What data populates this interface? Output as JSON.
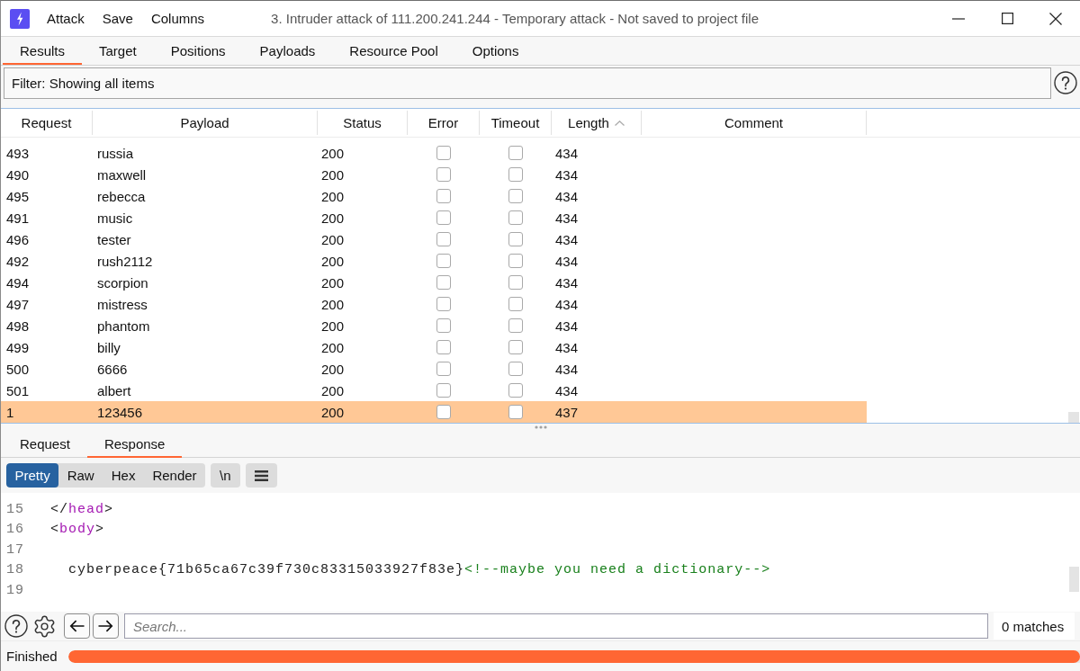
{
  "window": {
    "title": "3. Intruder attack of 111.200.241.244 - Temporary attack - Not saved to project file"
  },
  "menu": [
    "Attack",
    "Save",
    "Columns"
  ],
  "tabs": [
    {
      "label": "Results",
      "selected": true
    },
    {
      "label": "Target",
      "selected": false
    },
    {
      "label": "Positions",
      "selected": false
    },
    {
      "label": "Payloads",
      "selected": false
    },
    {
      "label": "Resource Pool",
      "selected": false
    },
    {
      "label": "Options",
      "selected": false
    }
  ],
  "filter": {
    "label": "Filter: Showing all items"
  },
  "table": {
    "columns": [
      {
        "label": "Request",
        "sorted": false
      },
      {
        "label": "Payload",
        "sorted": false
      },
      {
        "label": "Status",
        "sorted": false
      },
      {
        "label": "Error",
        "sorted": false
      },
      {
        "label": "Timeout",
        "sorted": false
      },
      {
        "label": "Length",
        "sorted": true
      },
      {
        "label": "Comment",
        "sorted": false
      }
    ],
    "rows": [
      {
        "request": "493",
        "payload": "russia",
        "status": "200",
        "error": false,
        "timeout": false,
        "length": "434",
        "selected": false
      },
      {
        "request": "490",
        "payload": "maxwell",
        "status": "200",
        "error": false,
        "timeout": false,
        "length": "434",
        "selected": false
      },
      {
        "request": "495",
        "payload": "rebecca",
        "status": "200",
        "error": false,
        "timeout": false,
        "length": "434",
        "selected": false
      },
      {
        "request": "491",
        "payload": "music",
        "status": "200",
        "error": false,
        "timeout": false,
        "length": "434",
        "selected": false
      },
      {
        "request": "496",
        "payload": "tester",
        "status": "200",
        "error": false,
        "timeout": false,
        "length": "434",
        "selected": false
      },
      {
        "request": "492",
        "payload": "rush2112",
        "status": "200",
        "error": false,
        "timeout": false,
        "length": "434",
        "selected": false
      },
      {
        "request": "494",
        "payload": "scorpion",
        "status": "200",
        "error": false,
        "timeout": false,
        "length": "434",
        "selected": false
      },
      {
        "request": "497",
        "payload": "mistress",
        "status": "200",
        "error": false,
        "timeout": false,
        "length": "434",
        "selected": false
      },
      {
        "request": "498",
        "payload": "phantom",
        "status": "200",
        "error": false,
        "timeout": false,
        "length": "434",
        "selected": false
      },
      {
        "request": "499",
        "payload": "billy",
        "status": "200",
        "error": false,
        "timeout": false,
        "length": "434",
        "selected": false
      },
      {
        "request": "500",
        "payload": "6666",
        "status": "200",
        "error": false,
        "timeout": false,
        "length": "434",
        "selected": false
      },
      {
        "request": "501",
        "payload": "albert",
        "status": "200",
        "error": false,
        "timeout": false,
        "length": "434",
        "selected": false
      },
      {
        "request": "1",
        "payload": "123456",
        "status": "200",
        "error": false,
        "timeout": false,
        "length": "437",
        "selected": true
      }
    ]
  },
  "message_tabs": [
    {
      "label": "Request",
      "selected": false
    },
    {
      "label": "Response",
      "selected": true
    }
  ],
  "view_modes": [
    {
      "label": "Pretty",
      "selected": true
    },
    {
      "label": "Raw",
      "selected": false
    },
    {
      "label": "Hex",
      "selected": false
    },
    {
      "label": "Render",
      "selected": false
    }
  ],
  "newline_toggle": {
    "label": "\\n",
    "on": false
  },
  "code": {
    "lines": [
      {
        "number": "15",
        "tokens": [
          {
            "kind": "text",
            "text": "  </"
          },
          {
            "kind": "tag",
            "text": "head"
          },
          {
            "kind": "text",
            "text": ">"
          }
        ]
      },
      {
        "number": "16",
        "tokens": [
          {
            "kind": "text",
            "text": "  <"
          },
          {
            "kind": "tag",
            "text": "body"
          },
          {
            "kind": "text",
            "text": ">"
          }
        ]
      },
      {
        "number": "17"
      },
      {
        "number": "18",
        "tokens": [
          {
            "kind": "text",
            "text": "    cyberpeace{71b65ca67c39f730c83315033927f83e}"
          },
          {
            "kind": "comment",
            "text": "<!--maybe you need a dictionary-->"
          }
        ]
      },
      {
        "number": "19"
      }
    ]
  },
  "search": {
    "placeholder": "Search...",
    "matches": "0 matches"
  },
  "status": {
    "text": "Finished",
    "level": 1
  }
}
